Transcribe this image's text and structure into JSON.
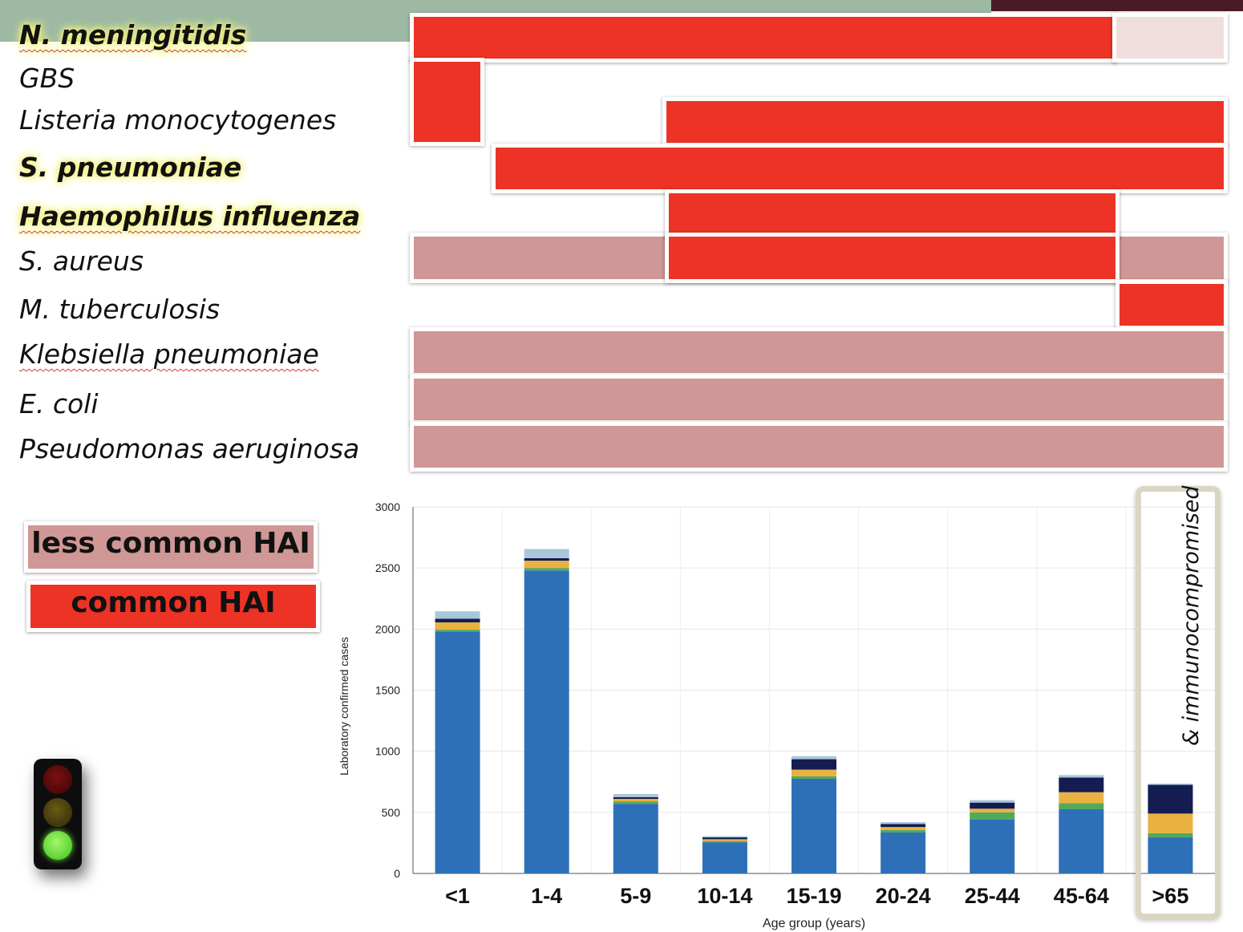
{
  "colors": {
    "common": "#ec3325",
    "less_common": "#cf9795",
    "partial": "#f0dedd",
    "header_green": "#9db9a4",
    "header_maroon": "#4b1a27"
  },
  "organisms": [
    {
      "name": "N. meningitidis"
    },
    {
      "name": "GBS"
    },
    {
      "name": "Listeria monocytogenes"
    },
    {
      "name": "S. pneumoniae"
    },
    {
      "name": "Haemophilus influenza"
    },
    {
      "name": "S. aureus"
    },
    {
      "name": "M. tuberculosis"
    },
    {
      "name": "Klebsiella pneumoniae"
    },
    {
      "name": "E. coli"
    },
    {
      "name": "Pseudomonas aeruginosa"
    }
  ],
  "legend": {
    "less_common": "less common HAI",
    "common": "common HAI"
  },
  "traffic_light": {
    "lit": "green"
  },
  "annotation": {
    "text": "&   immunocompromised"
  },
  "chart_data": {
    "type": "bar",
    "stacked": true,
    "categories": [
      "<1",
      "1-4",
      "5-9",
      "10-14",
      "15-19",
      "20-24",
      "25-44",
      "45-64",
      ">65"
    ],
    "xlabel": "Age group (years)",
    "ylabel": "Laboratory confirmed cases",
    "ylim": [
      0,
      3000
    ],
    "yticks": [
      0,
      500,
      1000,
      1500,
      2000,
      2500,
      3000
    ],
    "grid": true,
    "series": [
      {
        "color": "#2e70b7",
        "values": [
          1980,
          2480,
          570,
          255,
          775,
          335,
          440,
          525,
          295
        ]
      },
      {
        "color": "#52a95a",
        "values": [
          15,
          20,
          20,
          10,
          20,
          20,
          60,
          50,
          35
        ]
      },
      {
        "color": "#e9b140",
        "values": [
          60,
          60,
          20,
          15,
          55,
          25,
          30,
          90,
          160
        ]
      },
      {
        "color": "#141c52",
        "values": [
          30,
          20,
          15,
          15,
          85,
          25,
          50,
          120,
          235
        ]
      },
      {
        "color": "#a8c7da",
        "values": [
          60,
          75,
          25,
          10,
          25,
          15,
          20,
          20,
          10
        ]
      }
    ]
  }
}
